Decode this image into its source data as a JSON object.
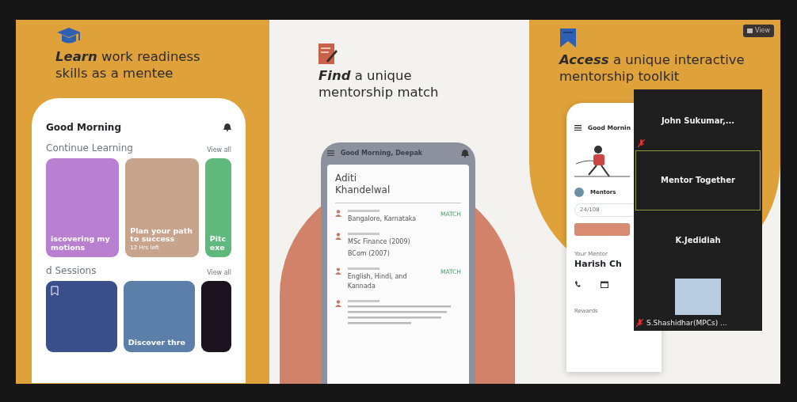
{
  "panels": [
    {
      "kind": "learn",
      "heading": "**Learn** work readiness skills as a mentee",
      "phone": {
        "greeting": "Good Morning",
        "section_1": {
          "title": "Continue Learning",
          "view_all": "View all",
          "cards": [
            {
              "title": "iscovering my motions",
              "color": "#b97fd0"
            },
            {
              "title": "Plan your path to success",
              "meta": "12 Hrs left",
              "color": "#c9a48c"
            },
            {
              "title": "Pitc exe",
              "color": "#5fb97c"
            }
          ]
        },
        "section_2": {
          "title": "d Sessions",
          "view_all": "View all",
          "cards": [
            {
              "bookmark": true,
              "color": "#3a4f8c"
            },
            {
              "title": "Discover thre",
              "color": "#5b7fa8"
            },
            {
              "color": "#1b1420"
            }
          ]
        }
      }
    },
    {
      "kind": "find",
      "heading": "**Find** a unique mentorship match",
      "phone": {
        "greeting": "Good Morning, Deepak",
        "name": "Aditi Khandelwal",
        "details": [
          {
            "values": [
              "Bangalore, Karnataka"
            ],
            "badge": "MATCH"
          },
          {
            "values": [
              "MSc Finance (2009)",
              "BCom (2007)"
            ]
          },
          {
            "values": [
              "English, Hindi, and Kannada"
            ],
            "badge": "MATCH"
          },
          {
            "kind": "bio"
          }
        ]
      }
    },
    {
      "kind": "access",
      "heading": "**Access** a unique interactive mentorship toolkit",
      "view_button": "View",
      "phone": {
        "greeting": "Good Mornin",
        "card_title": "Mentors",
        "progress": "24/108",
        "mentor_label": "Your Mentor",
        "mentor_name": "Harish Ch",
        "footer": "Rewards"
      }
    }
  ],
  "meeting": {
    "participants": [
      {
        "kind": "name",
        "name": "John  Sukumar,...",
        "muted": true,
        "selected": false
      },
      {
        "kind": "name",
        "name": "Mentor Together",
        "muted": false,
        "selected": true
      },
      {
        "kind": "name",
        "name": "K.Jedidiah",
        "muted": false,
        "selected": false
      },
      {
        "kind": "photo",
        "name": "S.Shashidhar(MPCs) ...",
        "muted": true,
        "selected": false
      }
    ]
  }
}
